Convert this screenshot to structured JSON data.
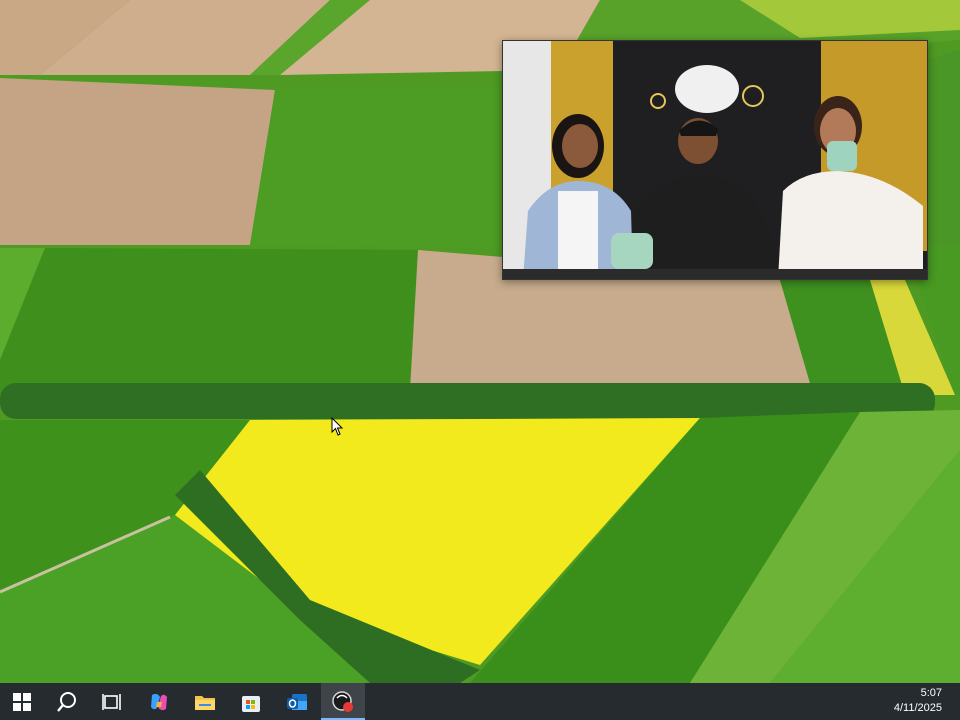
{
  "desktop": {
    "wallpaper": "aerial-farm-fields"
  },
  "video_window": {
    "content": "three-people-seated-video"
  },
  "taskbar": {
    "background": "#262b2f",
    "items": [
      {
        "name": "start-button",
        "icon": "windows-logo-icon"
      },
      {
        "name": "search-button",
        "icon": "search-icon"
      },
      {
        "name": "task-view-button",
        "icon": "task-view-icon"
      },
      {
        "name": "copilot-button",
        "icon": "copilot-icon"
      },
      {
        "name": "file-explorer-button",
        "icon": "folder-icon"
      },
      {
        "name": "microsoft-store-button",
        "icon": "store-icon"
      },
      {
        "name": "outlook-button",
        "icon": "outlook-icon"
      },
      {
        "name": "screen-recorder-button",
        "icon": "recorder-icon",
        "active": true
      }
    ]
  },
  "clock": {
    "time": "5:07",
    "date": "4/11/2025"
  }
}
